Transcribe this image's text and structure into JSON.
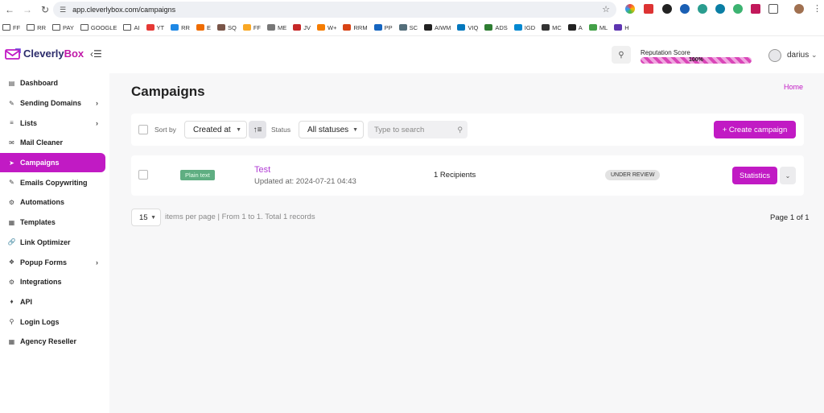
{
  "browser": {
    "url": "app.cleverlybox.com/campaigns",
    "back_icon": "arrow-left-icon",
    "forward_icon": "arrow-right-icon",
    "reload_icon": "reload-icon",
    "bookmarks": [
      "FF",
      "RR",
      "PAY",
      "GOOGLE",
      "AI",
      "YT",
      "RR",
      "E",
      "SQ",
      "FF",
      "ME",
      "JV",
      "W+",
      "RRM",
      "PP",
      "SC",
      "AIWM",
      "VIQ",
      "ADS",
      "IGD",
      "MC",
      "A",
      "ML",
      "H"
    ]
  },
  "brand": {
    "name_a": "Cleverly",
    "name_b": "Box",
    "accent": "#c11ac4"
  },
  "sidebar": {
    "items": [
      {
        "label": "Dashboard",
        "icon": "dashboard-icon"
      },
      {
        "label": "Sending Domains",
        "icon": "domain-icon",
        "has_children": true
      },
      {
        "label": "Lists",
        "icon": "list-icon",
        "has_children": true
      },
      {
        "label": "Mail Cleaner",
        "icon": "mail-icon"
      },
      {
        "label": "Campaigns",
        "icon": "send-icon",
        "active": true
      },
      {
        "label": "Emails Copywriting",
        "icon": "pencil-icon"
      },
      {
        "label": "Automations",
        "icon": "gear-icon"
      },
      {
        "label": "Templates",
        "icon": "template-icon"
      },
      {
        "label": "Link Optimizer",
        "icon": "link-icon"
      },
      {
        "label": "Popup Forms",
        "icon": "popup-icon",
        "has_children": true
      },
      {
        "label": "Integrations",
        "icon": "plug-icon"
      },
      {
        "label": "API",
        "icon": "api-icon"
      },
      {
        "label": "Login Logs",
        "icon": "search-icon"
      },
      {
        "label": "Agency Reseller",
        "icon": "building-icon"
      }
    ]
  },
  "header": {
    "reputation_label": "Reputation Score",
    "reputation_value": "100%",
    "reputation_fraction": 1.0,
    "username": "darius"
  },
  "page": {
    "title": "Campaigns",
    "breadcrumb_home": "Home"
  },
  "filters": {
    "sort_by_label": "Sort by",
    "sort_by_value": "Created at",
    "status_label": "Status",
    "status_value": "All statuses",
    "search_placeholder": "Type to search",
    "create_label": "+ Create campaign"
  },
  "campaigns": [
    {
      "type": "Plain text",
      "name": "Test",
      "updated": "Updated at: 2024-07-21 04:43",
      "recipients": "1 Recipients",
      "status": "UNDER REVIEW",
      "stats_label": "Statistics"
    }
  ],
  "pagination": {
    "per_page": "15",
    "per_page_label": "items per page",
    "summary": "| From 1 to 1. Total 1 records",
    "page_info": "Page 1 of 1"
  }
}
